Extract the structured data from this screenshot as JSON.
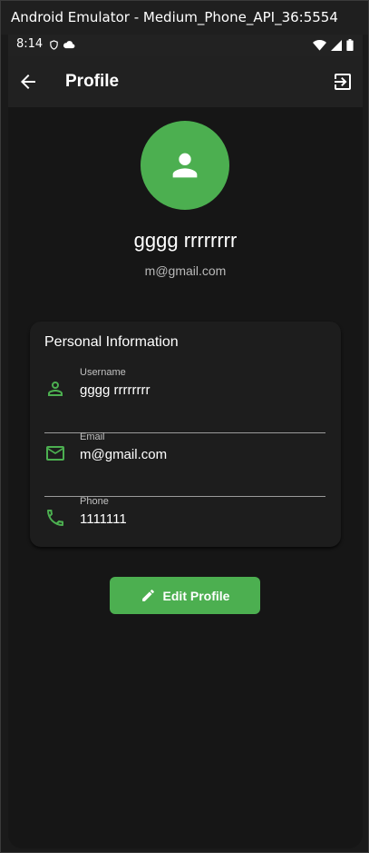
{
  "window": {
    "title": "Android Emulator - Medium_Phone_API_36:5554"
  },
  "statusbar": {
    "time": "8:14",
    "left_icons": [
      "shield-icon",
      "cloud-icon"
    ],
    "right_icons": [
      "wifi-icon",
      "signal-icon",
      "battery-icon"
    ]
  },
  "appbar": {
    "title": "Profile",
    "back_icon": "arrow-back-icon",
    "action_icon": "logout-icon"
  },
  "profile": {
    "avatar_icon": "person-icon",
    "name": "gggg rrrrrrrr",
    "email": "m@gmail.com"
  },
  "personal_info": {
    "title": "Personal Information",
    "rows": [
      {
        "label": "Username",
        "value": "gggg rrrrrrrr",
        "icon": "person-outline-icon"
      },
      {
        "label": "Email",
        "value": "m@gmail.com",
        "icon": "mail-icon"
      },
      {
        "label": "Phone",
        "value": "1111111",
        "icon": "phone-icon"
      }
    ]
  },
  "actions": {
    "edit_label": "Edit Profile",
    "edit_icon": "edit-pencil-icon"
  },
  "colors": {
    "accent": "#4caf50",
    "background": "#161616",
    "card": "#1d1d1d",
    "appbar": "#212121"
  }
}
